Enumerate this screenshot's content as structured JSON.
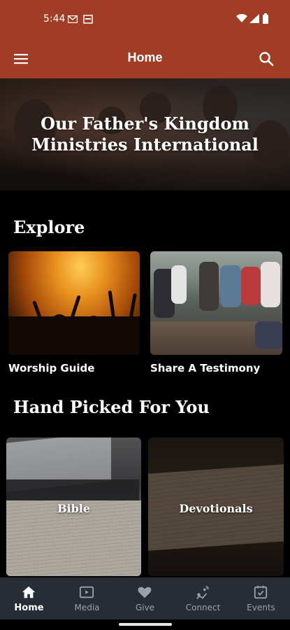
{
  "status_bar": {
    "time": "5:44",
    "left_icons": [
      "gmail-icon",
      "calendar-icon"
    ],
    "right_icons": [
      "wifi-icon",
      "signal-icon",
      "battery-icon"
    ]
  },
  "app_bar": {
    "title": "Home",
    "left_icon": "menu-icon",
    "right_icon": "search-icon",
    "background": "#a03d24"
  },
  "hero": {
    "headline_line1": "Our Father's Kingdom",
    "headline_line2": "Ministries International"
  },
  "explore": {
    "title": "Explore",
    "cards": [
      {
        "label": "Worship Guide"
      },
      {
        "label": "Share A Testimony"
      }
    ]
  },
  "hand_picked": {
    "title": "Hand Picked For You",
    "cards": [
      {
        "label": "Bible"
      },
      {
        "label": "Devotionals"
      }
    ]
  },
  "bottom_nav": {
    "background": "#262d35",
    "items": [
      {
        "label": "Home",
        "icon": "home-icon",
        "active": true
      },
      {
        "label": "Media",
        "icon": "video-icon",
        "active": false
      },
      {
        "label": "Give",
        "icon": "heart-icon",
        "active": false
      },
      {
        "label": "Connect",
        "icon": "connect-icon",
        "active": false
      },
      {
        "label": "Events",
        "icon": "calendar-check-icon",
        "active": false
      }
    ]
  }
}
